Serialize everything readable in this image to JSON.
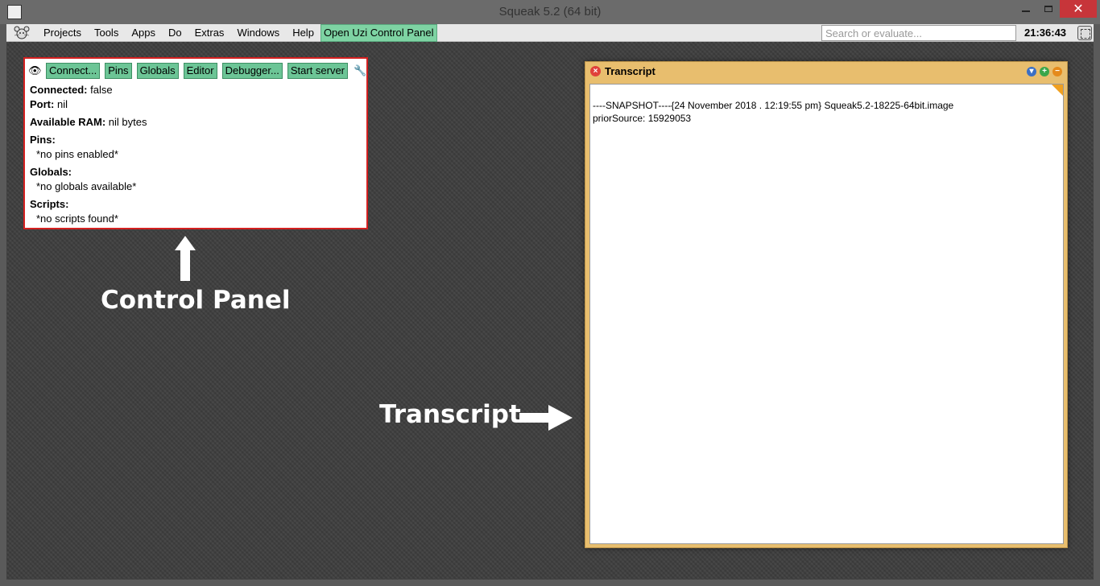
{
  "window": {
    "title": "Squeak 5.2 (64 bit)",
    "min_glyph": "—",
    "close_glyph": "✕"
  },
  "menubar": {
    "items": [
      "Projects",
      "Tools",
      "Apps",
      "Do",
      "Extras",
      "Windows",
      "Help"
    ],
    "highlight_item": "Open Uzi Control Panel",
    "search_placeholder": "Search or evaluate...",
    "clock": "21:36:43"
  },
  "control_panel": {
    "eye_glyph": "👁",
    "wrench_glyph": "🔧",
    "buttons": [
      "Connect...",
      "Pins",
      "Globals",
      "Editor",
      "Debugger...",
      "Start server"
    ],
    "connected_label": "Connected:",
    "connected_value": "false",
    "port_label": "Port:",
    "port_value": "nil",
    "ram_label": "Available RAM:",
    "ram_value": "nil bytes",
    "pins_label": "Pins:",
    "pins_value": "*no pins enabled*",
    "globals_label": "Globals:",
    "globals_value": "*no globals available*",
    "scripts_label": "Scripts:",
    "scripts_value": "*no scripts found*"
  },
  "annotations": {
    "control_panel_label": "Control Panel",
    "transcript_label": "Transcript"
  },
  "transcript": {
    "title": "Transcript",
    "close_glyph": "×",
    "menu_glyph": "▾",
    "expand_glyph": "+",
    "collapse_glyph": "−",
    "lines": [
      "----SNAPSHOT----{24 November 2018 . 12:19:55 pm} Squeak5.2-18225-64bit.image",
      "priorSource: 15929053"
    ]
  },
  "colors": {
    "button_green": "#6cc596",
    "panel_border": "#d42020",
    "transcript_frame": "#e8be6e"
  }
}
